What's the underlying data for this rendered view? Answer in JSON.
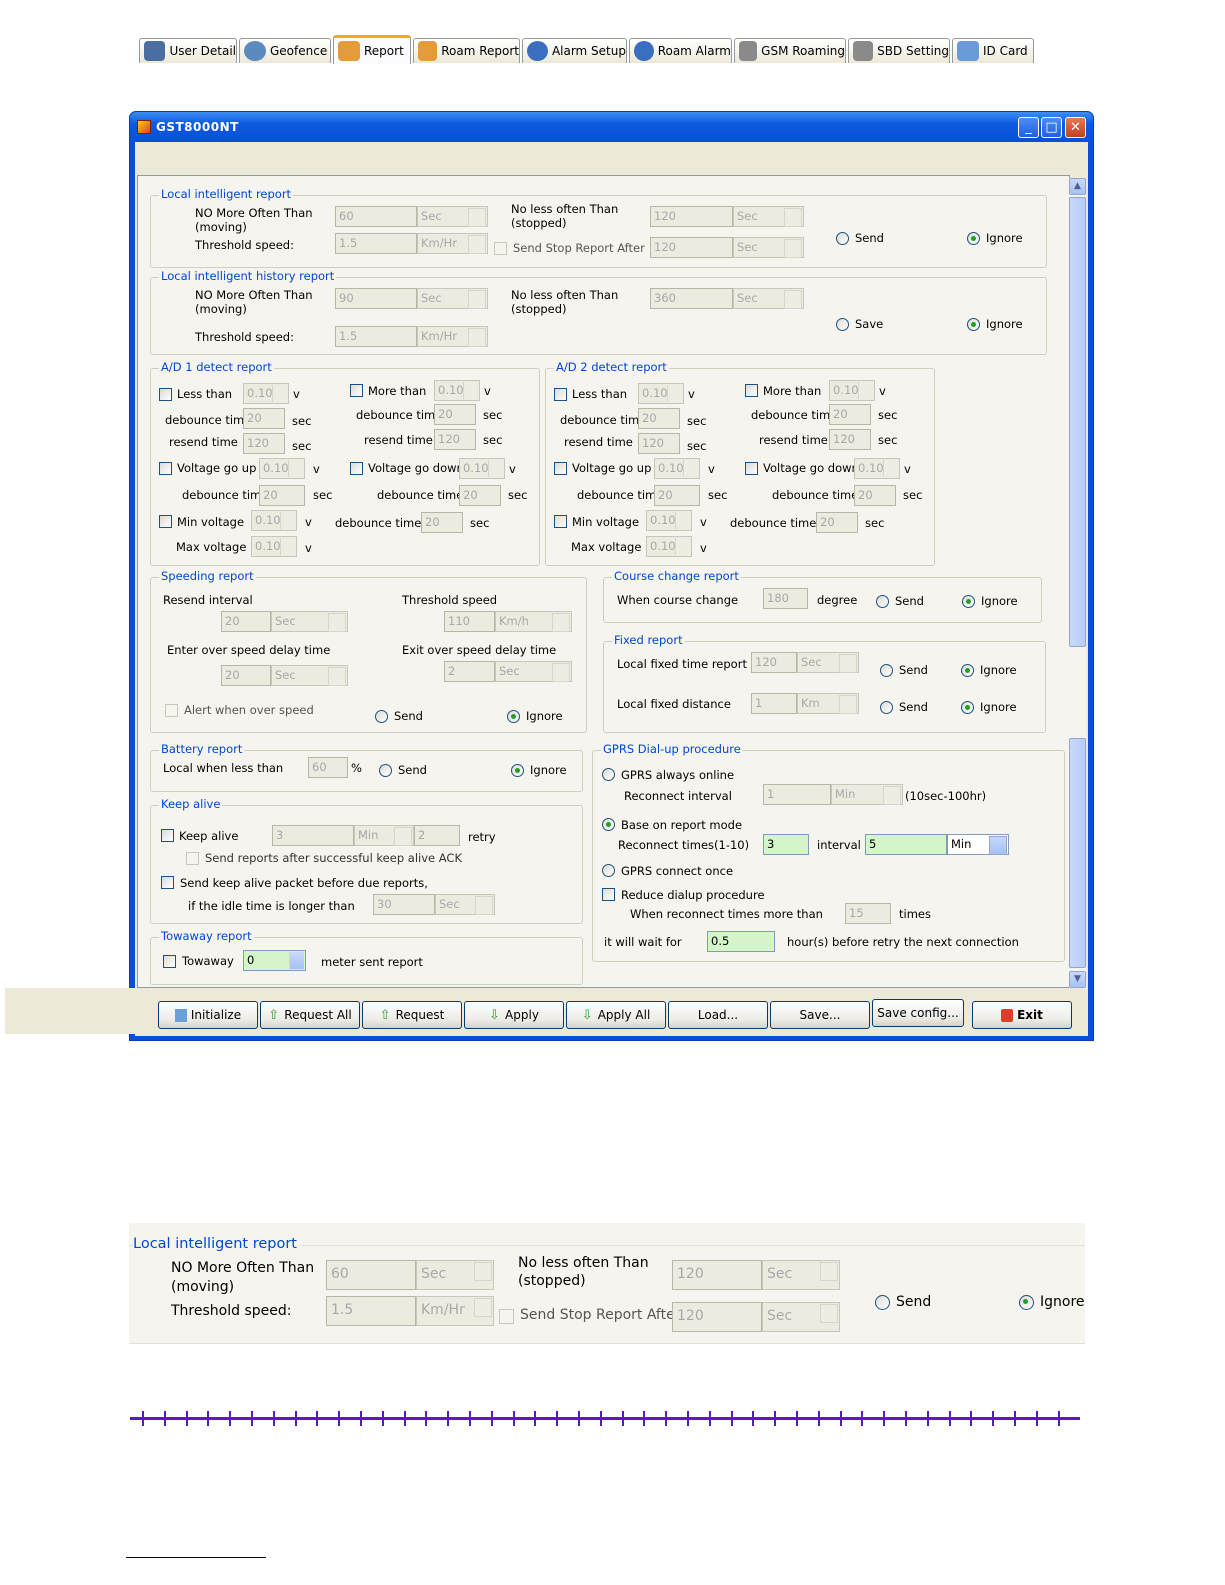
{
  "window": {
    "title": "GST8000NT"
  },
  "tabs": [
    "User Detail",
    "Geofence",
    "Report",
    "Roam Report",
    "Alarm Setup",
    "Roam Alarm",
    "GSM Roaming",
    "SBD Setting",
    "ID Card"
  ],
  "lir": {
    "title": "Local intelligent report",
    "nmo": "NO More Often Than",
    "moving": "(moving)",
    "thr": "Threshold speed:",
    "nlo": "No less often Than",
    "stopped": "(stopped)",
    "ssr": "Send Stop Report After",
    "v60": "60",
    "sec": "Sec",
    "v15": "1.5",
    "kmhr": "Km/Hr",
    "v120": "120",
    "send": "Send",
    "ignore": "Ignore"
  },
  "lihr": {
    "title": "Local intelligent history report",
    "v90": "90",
    "v360": "360",
    "save": "Save"
  },
  "ad1": {
    "title": "A/D 1 detect report"
  },
  "ad2": {
    "title": "A/D 2 detect report"
  },
  "ad": {
    "less": "Less than",
    "more": "More than",
    "v010": "0.10",
    "v": "v",
    "deb": "debounce time",
    "res": "resend time",
    "secl": "sec",
    "v20": "20",
    "v120": "120",
    "vgu": "Voltage go up",
    "vgd": "Voltage go down",
    "minv": "Min voltage",
    "maxv": "Max voltage"
  },
  "spd": {
    "title": "Speeding report",
    "resend": "Resend interval",
    "thr": "Threshold speed",
    "v20": "20",
    "sec": "Sec",
    "v110": "110",
    "kmh": "Km/h",
    "enter": "Enter over speed delay time",
    "exit": "Exit over speed delay time",
    "v2": "2",
    "alert": "Alert when over speed",
    "send": "Send",
    "ignore": "Ignore"
  },
  "course": {
    "title": "Course change report",
    "when": "When course change",
    "v180": "180",
    "degree": "degree"
  },
  "fixed": {
    "title": "Fixed report",
    "lft": "Local fixed time report",
    "v120": "120",
    "sec": "Sec",
    "lfd": "Local fixed distance",
    "v1": "1",
    "km": "Km"
  },
  "batt": {
    "title": "Battery report",
    "local": "Local when less than",
    "v60": "60",
    "pct": "%"
  },
  "keep": {
    "title": "Keep alive",
    "ka": "Keep alive",
    "v3": "3",
    "min": "Min",
    "v2": "2",
    "retry": "retry",
    "sra": "Send reports after successful keep alive ACK",
    "skp": "Send keep alive packet before due reports,",
    "idle": "if the idle time is longer than",
    "v30": "30",
    "sec": "Sec"
  },
  "tow": {
    "title": "Towaway report",
    "tw": "Towaway",
    "v0": "0",
    "msr": "meter sent report"
  },
  "gprs": {
    "title": "GPRS Dial-up procedure",
    "always": "GPRS always online",
    "reconn": "Reconnect interval",
    "v1": "1",
    "min": "Min",
    "range": "(10sec-100hr)",
    "base": "Base on report mode",
    "times": "Reconnect times(1-10)",
    "v3": "3",
    "interval": "interval",
    "v5": "5",
    "once": "GPRS connect once",
    "reduce": "Reduce dialup procedure",
    "more": "When reconnect times more than",
    "v15": "15",
    "timesl": "times",
    "wait": "it will wait for",
    "v05": "0.5",
    "hour": "hour(s) before retry the next connection"
  },
  "buttons": [
    "Initialize",
    "Request All",
    "Request",
    "Apply",
    "Apply All",
    "Load...",
    "Save...",
    "Save config...",
    "Exit"
  ]
}
